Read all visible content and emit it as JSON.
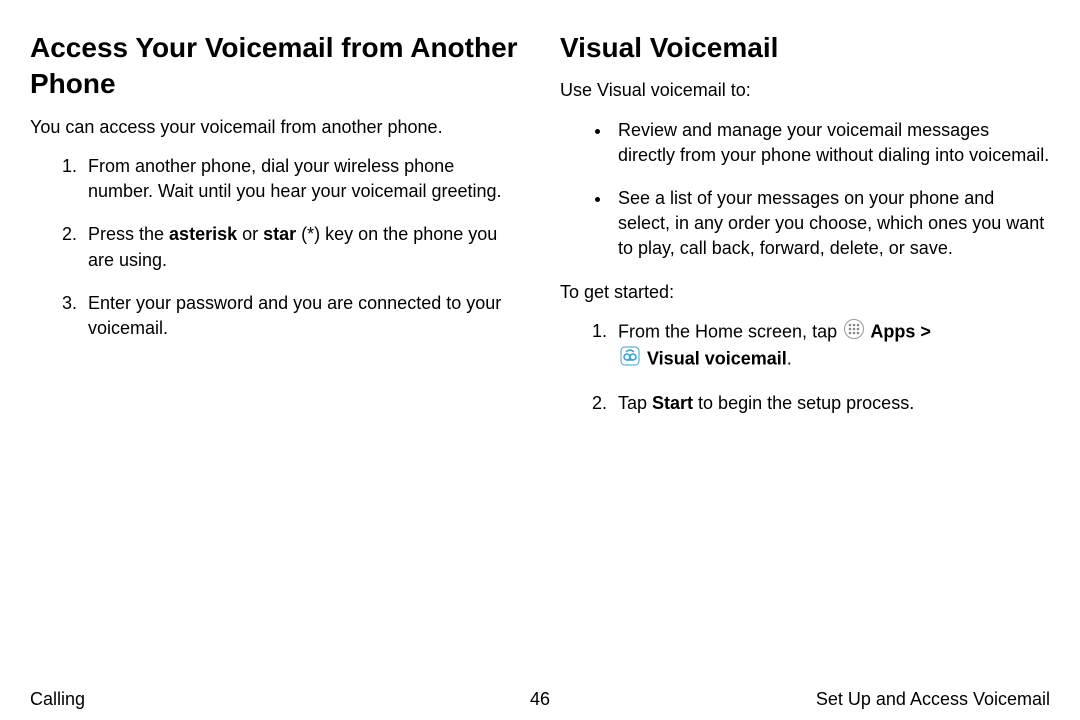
{
  "left": {
    "heading": "Access Your Voicemail from Another Phone",
    "intro": "You can access your voicemail from another phone.",
    "step1": "From another phone, dial your wireless phone number. Wait until you hear your voicemail greeting.",
    "step2_a": "Press the ",
    "step2_b1": "asterisk",
    "step2_c": " or ",
    "step2_b2": "star",
    "step2_d": " (*) key on the phone you are using.",
    "step3": "Enter your password and you are connected to your voicemail."
  },
  "right": {
    "heading": "Visual Voicemail",
    "intro": "Use Visual voicemail to:",
    "bullet1": "Review and manage your voicemail messages directly from your phone without dialing into voicemail.",
    "bullet2": "See a list of your messages on your phone and select, in any order you choose, which ones you want to play, call back, forward, delete, or save.",
    "started": "To get started:",
    "step1_a": "From the Home screen, tap ",
    "step1_b": " Apps > ",
    "step1_c": " Visual voicemail",
    "step1_d": ".",
    "step2_a": "Tap ",
    "step2_b": "Start",
    "step2_c": " to begin the setup process."
  },
  "footer": {
    "left": "Calling",
    "page": "46",
    "right": "Set Up and Access Voicemail"
  }
}
